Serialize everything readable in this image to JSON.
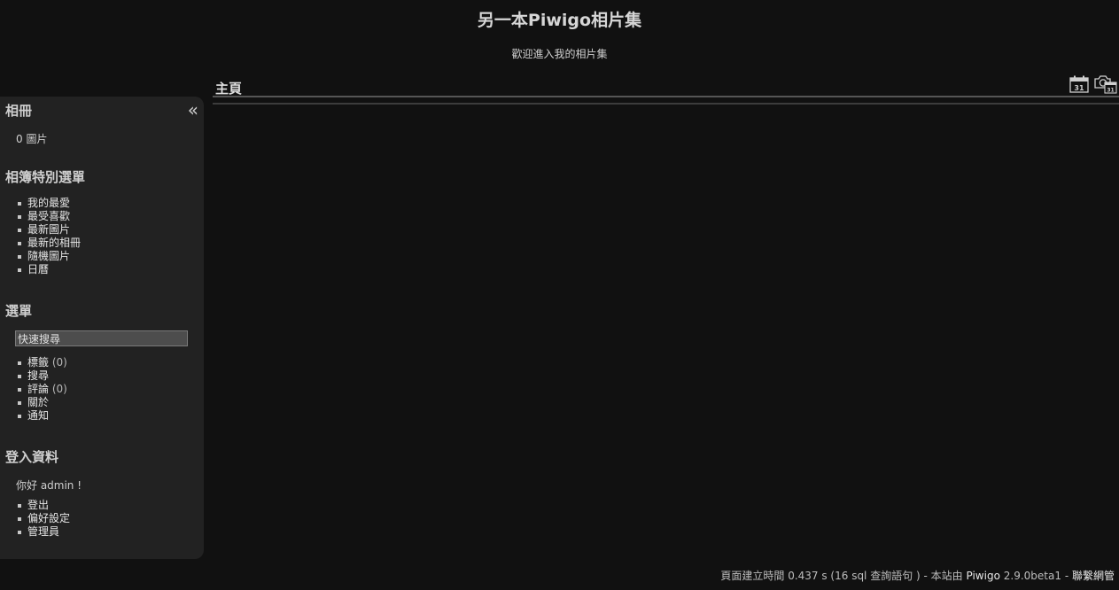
{
  "header": {
    "title": "另一本Piwigo相片集",
    "subtitle": "歡迎進入我的相片集"
  },
  "menu": {
    "collapse_icon": "«",
    "albums": {
      "heading": "相冊",
      "summary": "0 圖片"
    },
    "specials": {
      "heading": "相簿特別選單",
      "items": [
        "我的最愛",
        "最受喜歡",
        "最新圖片",
        "最新的相冊",
        "隨機圖片",
        "日曆"
      ]
    },
    "menu_section": {
      "heading": "選單",
      "search_value": "快速搜尋",
      "items": [
        {
          "label": "標籤",
          "count": "(0)"
        },
        {
          "label": "搜尋",
          "count": ""
        },
        {
          "label": "評論",
          "count": "(0)"
        },
        {
          "label": "關於",
          "count": ""
        },
        {
          "label": "通知",
          "count": ""
        }
      ]
    },
    "identification": {
      "heading": "登入資料",
      "greeting": "你好 admin !",
      "items": [
        "登出",
        "偏好設定",
        "管理員"
      ]
    }
  },
  "content": {
    "page_title": "主頁",
    "icons": [
      "calendar-icon",
      "camera-calendar-icon"
    ],
    "calendar_day": "31"
  },
  "footer": {
    "generated_text": "頁面建立時間 0.437 s (16 sql 查詢語句 ) - 本站由",
    "piwigo_link": "Piwigo",
    "version": "2.9.0beta1",
    "separator": "-",
    "contact_link": "聯繫網管"
  }
}
